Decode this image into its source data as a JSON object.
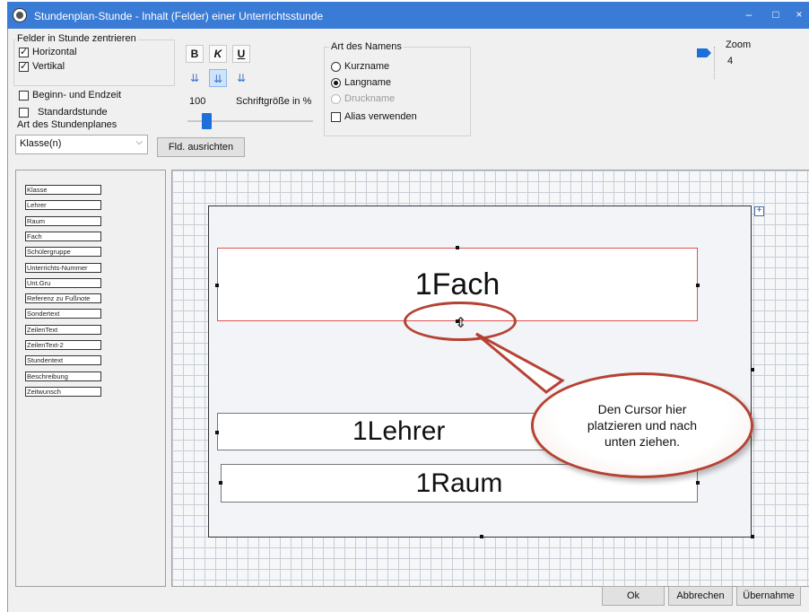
{
  "window": {
    "title": "Stundenplan-Stunde - Inhalt (Felder) einer Unterrichtsstunde",
    "minimize": "–",
    "maximize": "□",
    "close": "×"
  },
  "center_group": {
    "label": "Felder in Stunde zentrieren",
    "horizontal": "Horizontal",
    "vertikal": "Vertikal",
    "horizontal_checked": true,
    "vertikal_checked": true
  },
  "options": {
    "beginn_endzeit": "Beginn- und Endzeit",
    "standardstunde": "Standardstunde"
  },
  "format": {
    "bold": "B",
    "italic": "K",
    "underline": "U",
    "font_size_value": "100",
    "font_size_label": "Schriftgröße in %",
    "font_slider_fraction": 0.15
  },
  "plan_type": {
    "label": "Art des Stundenplanes",
    "selected": "Klasse(n)"
  },
  "align_fields_button": "Fld. ausrichten",
  "name_type": {
    "label": "Art des Namens",
    "kurzname": "Kurzname",
    "langname": "Langname",
    "druckname": "Druckname",
    "alias": "Alias verwenden",
    "selected": "Langname"
  },
  "zoom": {
    "label": "Zoom",
    "value": "4"
  },
  "field_list": [
    "Klasse",
    "Lehrer",
    "Raum",
    "Fach",
    "Schülergruppe",
    "Unterrichts-Nummer",
    "Unt.Gru",
    "Referenz zu Fußnote",
    "Sondertext",
    "ZeilenText",
    "ZeilenText-2",
    "Stundentext",
    "Beschreibung",
    "Zeitwunsch"
  ],
  "canvas": {
    "fach": "1Fach",
    "lehrer": "1Lehrer",
    "raum": "1Raum"
  },
  "callout": {
    "text": "Den Cursor hier platzieren und nach unten ziehen."
  },
  "footer": {
    "ok": "Ok",
    "cancel": "Abbrechen",
    "apply": "Übernahme"
  },
  "colors": {
    "titlebar": "#3a7bd5",
    "callout_border": "#b54334",
    "selected_field_border": "#e05050"
  }
}
